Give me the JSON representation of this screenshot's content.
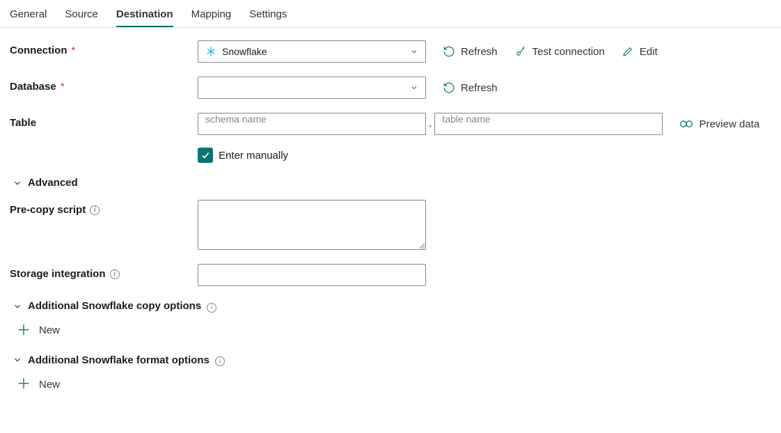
{
  "tabs": [
    {
      "label": "General"
    },
    {
      "label": "Source"
    },
    {
      "label": "Destination",
      "active": true
    },
    {
      "label": "Mapping"
    },
    {
      "label": "Settings"
    }
  ],
  "labels": {
    "connection": "Connection",
    "database": "Database",
    "table": "Table",
    "advanced": "Advanced",
    "precopy": "Pre-copy script",
    "storage": "Storage integration",
    "copyopts": "Additional Snowflake copy options",
    "formatopts": "Additional Snowflake format options"
  },
  "connection": {
    "selected": "Snowflake"
  },
  "table": {
    "schema_placeholder": "schema name",
    "table_placeholder": "table name",
    "enter_manually": "Enter manually",
    "checked": true
  },
  "actions": {
    "refresh": "Refresh",
    "test": "Test connection",
    "edit": "Edit",
    "preview": "Preview data",
    "new": "New"
  }
}
